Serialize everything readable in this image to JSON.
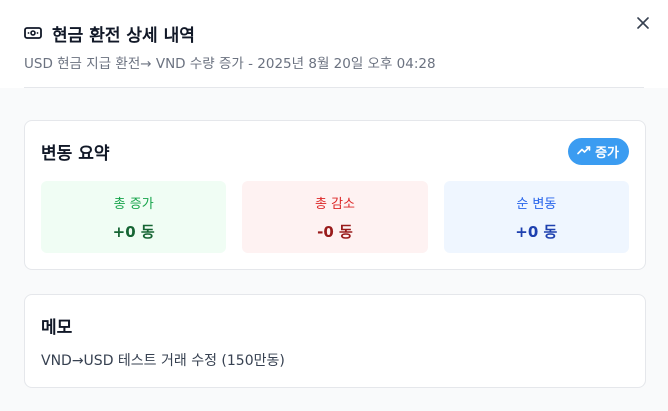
{
  "header": {
    "title": "현금 환전 상세 내역",
    "subtitle": "USD 현금 지급 환전→ VND 수량 증가 - 2025년 8월 20일 오후 04:28",
    "icon": "cash-icon",
    "close_icon": "close-icon"
  },
  "summary": {
    "title": "변동 요약",
    "badge": {
      "label": "증가",
      "icon": "trending-up-icon",
      "color": "#3b9cf1"
    },
    "stats": [
      {
        "label": "총 증가",
        "value": "+0 동",
        "color": "#16a34a"
      },
      {
        "label": "총 감소",
        "value": "-0 동",
        "color": "#dc2626"
      },
      {
        "label": "순 변동",
        "value": "+0 동",
        "color": "#2563eb"
      }
    ]
  },
  "memo": {
    "title": "메모",
    "text": "VND→USD 테스트 거래 수정 (150만동)"
  }
}
